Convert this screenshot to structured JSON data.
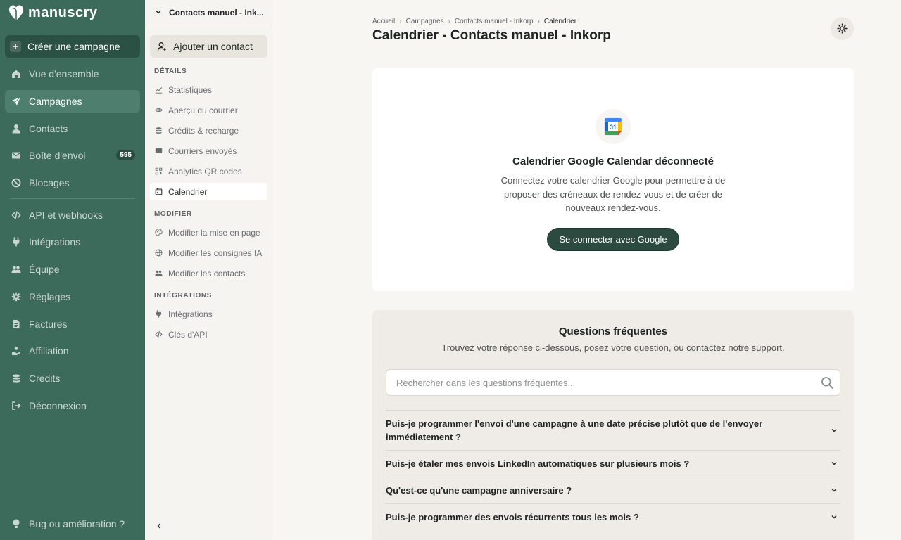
{
  "brand": {
    "name": "manuscry"
  },
  "sidebar": {
    "create_label": "Créer une campagne",
    "items": [
      {
        "label": "Vue d'ensemble",
        "icon": "home-icon"
      },
      {
        "label": "Campagnes",
        "icon": "paper-plane-icon",
        "active": true
      },
      {
        "label": "Contacts",
        "icon": "user-icon"
      },
      {
        "label": "Boîte d'envoi",
        "icon": "envelope-icon",
        "badge": "595"
      },
      {
        "label": "Blocages",
        "icon": "ban-icon"
      },
      {
        "label": "API et webhooks",
        "icon": "code-icon"
      },
      {
        "label": "Intégrations",
        "icon": "plug-icon"
      },
      {
        "label": "Équipe",
        "icon": "users-icon"
      },
      {
        "label": "Réglages",
        "icon": "gear-icon"
      },
      {
        "label": "Factures",
        "icon": "file-icon"
      },
      {
        "label": "Affiliation",
        "icon": "hand-coin-icon"
      },
      {
        "label": "Crédits",
        "icon": "coins-icon"
      },
      {
        "label": "Déconnexion",
        "icon": "logout-icon"
      }
    ],
    "bug_label": "Bug ou amélioration ?"
  },
  "subbar": {
    "campaign_name": "Contacts manuel - Ink...",
    "add_contact_label": "Ajouter un contact",
    "sections": [
      {
        "title": "DÉTAILS",
        "items": [
          {
            "label": "Statistiques",
            "icon": "chart-line-icon"
          },
          {
            "label": "Aperçu du courrier",
            "icon": "eye-icon"
          },
          {
            "label": "Crédits & recharge",
            "icon": "coins-icon"
          },
          {
            "label": "Courriers envoyés",
            "icon": "envelope-icon"
          },
          {
            "label": "Analytics QR codes",
            "icon": "qr-code-icon"
          },
          {
            "label": "Calendrier",
            "icon": "calendar-icon",
            "active": true
          }
        ]
      },
      {
        "title": "MODIFIER",
        "items": [
          {
            "label": "Modifier la mise en page",
            "icon": "palette-icon"
          },
          {
            "label": "Modifier les consignes IA",
            "icon": "globe-icon"
          },
          {
            "label": "Modifier les contacts",
            "icon": "users-icon"
          }
        ]
      },
      {
        "title": "INTÉGRATIONS",
        "items": [
          {
            "label": "Intégrations",
            "icon": "plug-icon"
          },
          {
            "label": "Clés d'API",
            "icon": "code-icon"
          }
        ]
      }
    ]
  },
  "breadcrumb": [
    "Accueil",
    "Campagnes",
    "Contacts manuel - Inkorp",
    "Calendrier"
  ],
  "page_title": "Calendrier - Contacts manuel - Inkorp",
  "calendar": {
    "icon_day": "31",
    "title": "Calendrier Google Calendar déconnecté",
    "description": "Connectez votre calendrier Google pour permettre à de proposer des créneaux de rendez-vous et de créer de nouveaux rendez-vous.",
    "connect_label": "Se connecter avec Google"
  },
  "faq": {
    "title": "Questions fréquentes",
    "subtitle": "Trouvez votre réponse ci-dessous, posez votre question, ou contactez notre support.",
    "search_placeholder": "Rechercher dans les questions fréquentes...",
    "items": [
      "Puis-je programmer l'envoi d'une campagne à une date précise plutôt que de l'envoyer immédiatement ?",
      "Puis-je étaler mes envois LinkedIn automatiques sur plusieurs mois ?",
      "Qu'est-ce qu'une campagne anniversaire ?",
      "Puis-je programmer des envois récurrents tous les mois ?"
    ]
  },
  "colors": {
    "sidebar": "#3d6b5b",
    "sidebar_active": "#4e7e6d",
    "accent_button": "#2c4a40",
    "background": "#f8f6f3"
  }
}
